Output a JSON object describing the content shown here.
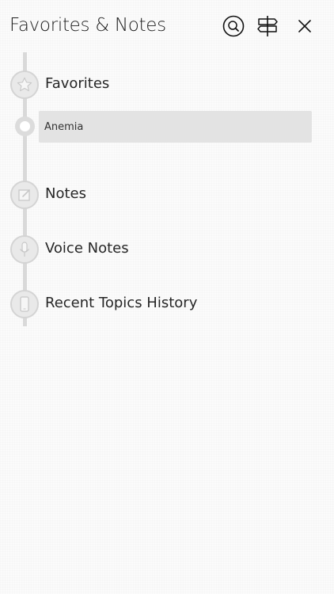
{
  "header": {
    "title": "Favorites & Notes",
    "icons": {
      "search": "search-icon",
      "signpost": "signpost-icon",
      "close": "close-icon"
    }
  },
  "sections": [
    {
      "label": "Favorites",
      "icon": "star-icon"
    },
    {
      "label": "Notes",
      "icon": "edit-note-icon"
    },
    {
      "label": "Voice Notes",
      "icon": "microphone-icon"
    },
    {
      "label": "Recent Topics History",
      "icon": "phone-icon"
    }
  ],
  "favorites": {
    "items": [
      {
        "label": "Anemia"
      }
    ]
  },
  "colors": {
    "background": "#fbfbfb",
    "rail": "#d9d9d9",
    "selected_item": "#e3e3e3",
    "text": "#262626"
  }
}
